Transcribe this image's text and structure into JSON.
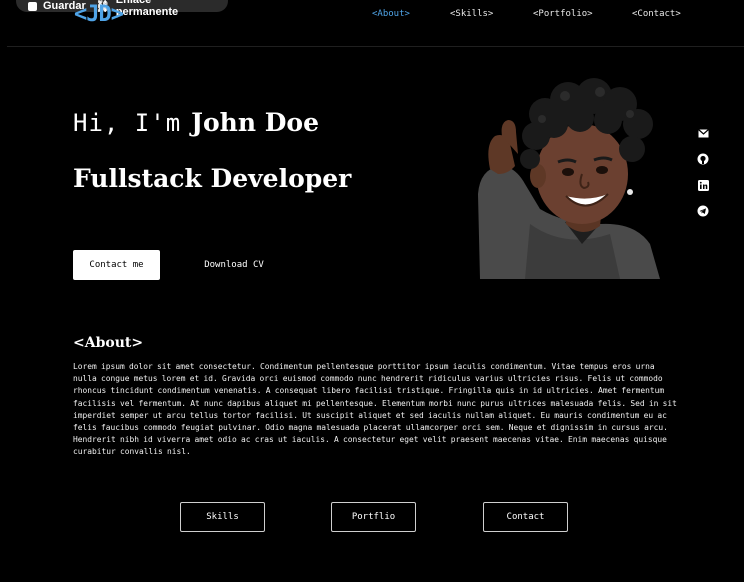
{
  "overlay": {
    "save_label": "Guardar",
    "permalink_label": "Enlace permanente"
  },
  "logo": {
    "text": "<JD>"
  },
  "nav": {
    "about": "<About>",
    "skills": "<Skills>",
    "portfolio": "<Portfolio>",
    "contact": "<Contact>"
  },
  "hero": {
    "greeting": "Hi, I'm",
    "name": "John Doe",
    "role": "Fullstack Developer",
    "contact_button": "Contact me",
    "cv_button": "Download CV"
  },
  "social": [
    "mail-icon",
    "github-icon",
    "linkedin-icon",
    "telegram-icon"
  ],
  "about": {
    "title": "<About>",
    "text": "Lorem ipsum dolor sit amet consectetur. Condimentum pellentesque porttitor ipsum iaculis condimentum. Vitae tempus eros urna nulla congue metus lorem et id. Gravida orci euismod commodo nunc hendrerit ridiculus varius ultricies risus. Felis ut commodo rhoncus tincidunt condimentum venenatis. A consequat libero facilisi tristique. Fringilla quis in id ultricies. Amet fermentum facilisis vel fermentum. At nunc dapibus aliquet mi pellentesque. Elementum morbi nunc purus ultrices malesuada felis. Sed in sit imperdiet semper ut arcu tellus tortor facilisi. Ut suscipit aliquet et sed iaculis nullam aliquet. Eu mauris condimentum eu ac felis faucibus commodo feugiat pulvinar. Odio magna malesuada placerat ullamcorper orci sem. Neque et dignissim in cursus arcu. Hendrerit nibh id viverra amet odio ac cras ut iaculis. A consectetur eget velit praesent maecenas vitae. Enim maecenas quisque curabitur convallis nisl."
  },
  "bottom_buttons": {
    "skills": "Skills",
    "portfolio": "Portflio",
    "contact": "Contact"
  },
  "colors": {
    "accent": "#4fa3e6",
    "background": "#000000"
  }
}
